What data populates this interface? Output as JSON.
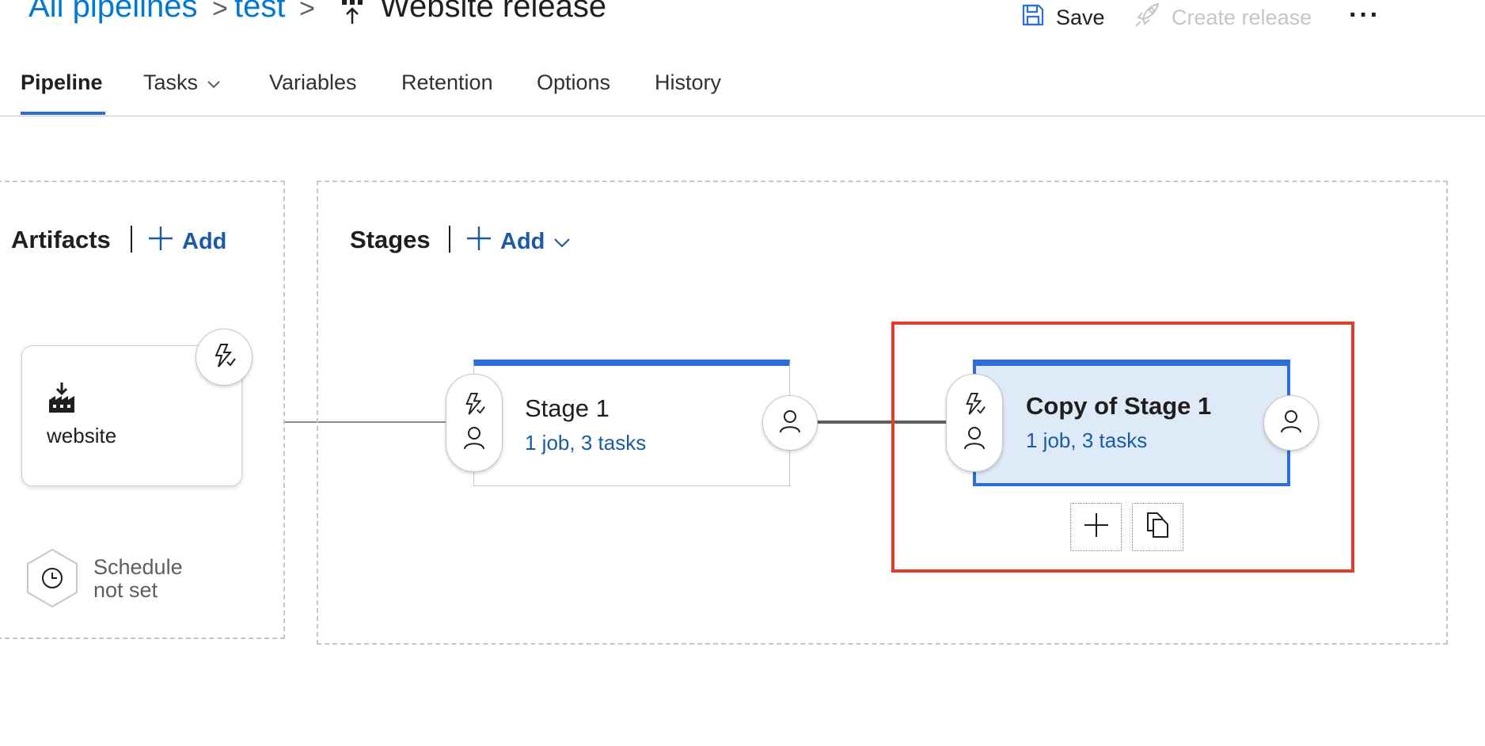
{
  "breadcrumb": {
    "items": [
      "All pipelines",
      "test"
    ],
    "separator": ">",
    "title": "Website release"
  },
  "toolbar": {
    "save_label": "Save",
    "create_release_label": "Create release",
    "more_label": "···"
  },
  "tabs": [
    {
      "label": "Pipeline",
      "active": true
    },
    {
      "label": "Tasks",
      "has_dropdown": true
    },
    {
      "label": "Variables"
    },
    {
      "label": "Retention"
    },
    {
      "label": "Options"
    },
    {
      "label": "History"
    }
  ],
  "artifacts": {
    "title": "Artifacts",
    "add_label": "Add",
    "items": [
      {
        "name": "website",
        "icon": "build-artifact-icon"
      }
    ],
    "schedule": {
      "line1": "Schedule",
      "line2": "not set"
    }
  },
  "stages": {
    "title": "Stages",
    "add_label": "Add",
    "items": [
      {
        "name": "Stage 1",
        "summary": "1 job, 3 tasks",
        "selected": false
      },
      {
        "name": "Copy of Stage 1",
        "summary": "1 job, 3 tasks",
        "selected": true
      }
    ]
  },
  "colors": {
    "accent": "#2b6fd6",
    "link": "#1c5ba4",
    "selected_fill": "#deeaf7",
    "highlight": "#e03e2d"
  }
}
